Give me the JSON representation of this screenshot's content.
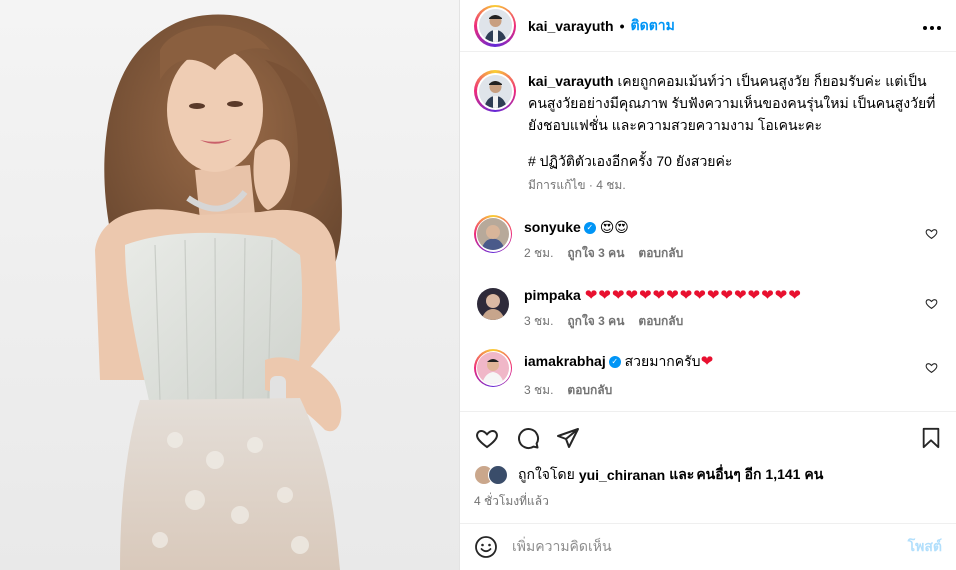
{
  "header": {
    "username": "kai_varayuth",
    "separator": "•",
    "follow_label": "ติดตาม",
    "more_label": "..."
  },
  "caption": {
    "username": "kai_varayuth",
    "text": "เคยถูกคอมเม้นท์ว่า เป็นคนสูงวัย ก็ยอมรับค่ะ แต่เป็นคนสูงวัยอย่างมีคุณภาพ รับฟังความเห็นของคนรุ่นใหม่ เป็นคนสูงวัยที่ยังชอบแฟชั่น และความสวยความงาม โอเคนะคะ",
    "hashtag": "# ปฏิวัติตัวเองอีกครั้ง 70 ยังสวยค่ะ",
    "edited_time": "มีการแก้ไข · 4 ชม."
  },
  "comments": [
    {
      "username": "sonyuke",
      "verified": true,
      "text": "😍😍",
      "time": "2 ชม.",
      "likes": "ถูกใจ 3 คน",
      "reply": "ตอบกลับ"
    },
    {
      "username": "pimpaka",
      "verified": false,
      "text": "❤❤❤❤❤❤❤❤❤❤❤❤❤❤❤❤",
      "time": "3 ชม.",
      "likes": "ถูกใจ 3 คน",
      "reply": "ตอบกลับ"
    },
    {
      "username": "iamakrabhaj",
      "verified": true,
      "text": "สวยมากครับ",
      "text_heart": "❤",
      "time": "3 ชม.",
      "reply": "ตอบกลับ"
    }
  ],
  "likes_line": {
    "prefix": "ถูกใจโดย",
    "user": "yui_chiranan",
    "and": "และ",
    "others": "คนอื่นๆ อีก 1,141 คน"
  },
  "post_time": "4 ชั่วโมงที่แล้ว",
  "add_comment": {
    "placeholder": "เพิ่มความคิดเห็น",
    "post_label": "โพสต์"
  },
  "icons": {
    "like": "heart-icon",
    "comment": "comment-icon",
    "share": "share-icon",
    "save": "bookmark-icon",
    "emoji": "emoji-icon",
    "more": "more-icon"
  },
  "colors": {
    "accent": "#0095f6",
    "heart": "#e8102f"
  }
}
